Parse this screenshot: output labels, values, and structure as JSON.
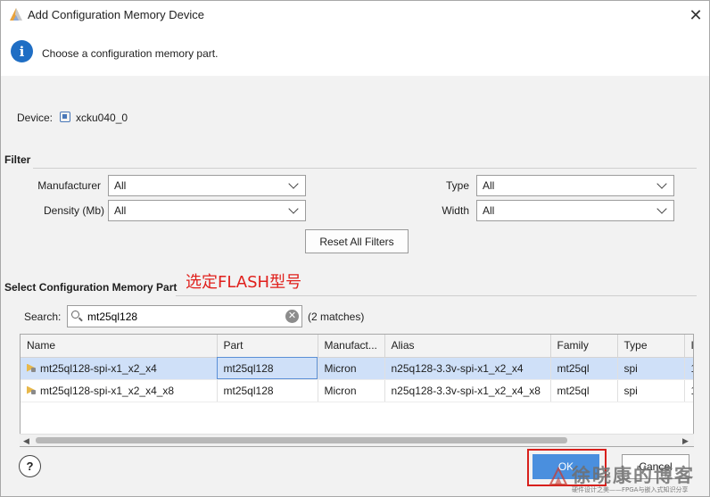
{
  "window": {
    "title": "Add Configuration Memory Device",
    "close_glyph": "✕"
  },
  "header": {
    "instruction": "Choose a configuration memory part.",
    "info_glyph": "i"
  },
  "device": {
    "label": "Device:",
    "value": "xcku040_0"
  },
  "filter": {
    "title": "Filter",
    "manufacturer_label": "Manufacturer",
    "manufacturer_value": "All",
    "density_label": "Density (Mb)",
    "density_value": "All",
    "type_label": "Type",
    "type_value": "All",
    "width_label": "Width",
    "width_value": "All",
    "reset_label": "Reset All Filters"
  },
  "select_section": {
    "title": "Select Configuration Memory Part",
    "annotation": "选定FLASH型号"
  },
  "search": {
    "label": "Search:",
    "value": "mt25ql128",
    "clear_glyph": "✕",
    "matches": "(2 matches)"
  },
  "table": {
    "columns": [
      "Name",
      "Part",
      "Manufact...",
      "Alias",
      "Family",
      "Type",
      "I"
    ],
    "rows": [
      {
        "name": "mt25ql128-spi-x1_x2_x4",
        "part": "mt25ql128",
        "manufacturer": "Micron",
        "alias": "n25q128-3.3v-spi-x1_x2_x4",
        "family": "mt25ql",
        "type": "spi",
        "extra": "1"
      },
      {
        "name": "mt25ql128-spi-x1_x2_x4_x8",
        "part": "mt25ql128",
        "manufacturer": "Micron",
        "alias": "n25q128-3.3v-spi-x1_x2_x4_x8",
        "family": "mt25ql",
        "type": "spi",
        "extra": "1"
      }
    ],
    "selected_row": 0
  },
  "buttons": {
    "help": "?",
    "ok": "OK",
    "cancel": "Cancel"
  },
  "watermark": {
    "title": "徐晓康的博客",
    "subtitle": "硬件设计之美——FPGA与嵌入式知识分享"
  },
  "colors": {
    "accent": "#4a8fde",
    "selection": "#cfe0f8",
    "annotation": "#e0201c",
    "info": "#1f6ec4"
  }
}
